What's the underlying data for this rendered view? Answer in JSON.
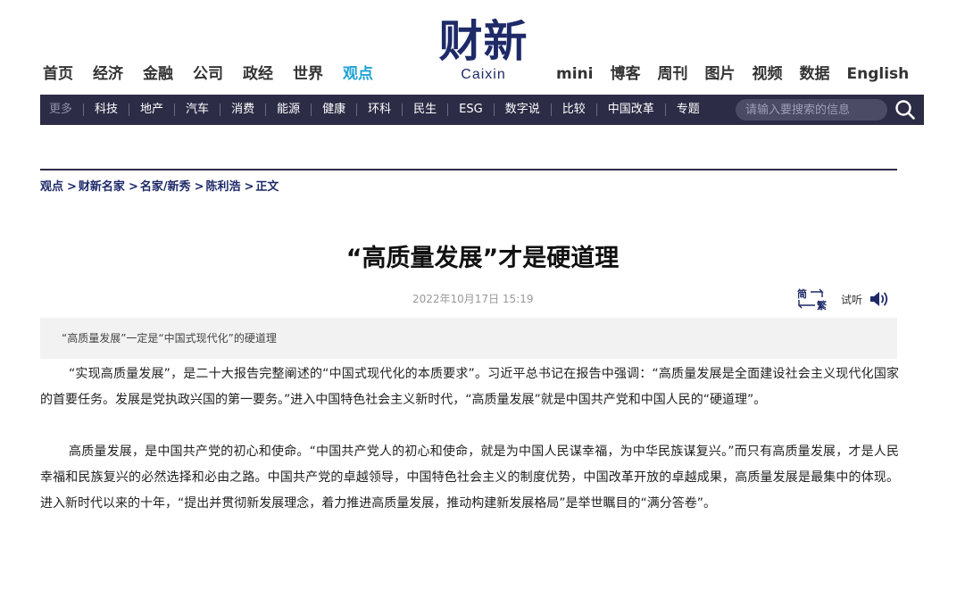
{
  "logo": {
    "cn": "财新",
    "en": "Caixin"
  },
  "nav_left": [
    {
      "label": "首页",
      "active": false
    },
    {
      "label": "经济",
      "active": false
    },
    {
      "label": "金融",
      "active": false
    },
    {
      "label": "公司",
      "active": false
    },
    {
      "label": "政经",
      "active": false
    },
    {
      "label": "世界",
      "active": false
    },
    {
      "label": "观点",
      "active": true
    }
  ],
  "nav_right": [
    "mini",
    "博客",
    "周刊",
    "图片",
    "视频",
    "数据",
    "English"
  ],
  "subnav": [
    "更多",
    "科技",
    "地产",
    "汽车",
    "消费",
    "能源",
    "健康",
    "环科",
    "民生",
    "ESG",
    "数字说",
    "比较",
    "中国改革",
    "专题"
  ],
  "search": {
    "placeholder": "请输入要搜索的信息",
    "icon": "search-icon"
  },
  "breadcrumb": [
    "观点",
    "财新名家",
    "名家/新秀",
    "陈利浩",
    "正文"
  ],
  "breadcrumb_sep": ">",
  "article": {
    "title": "“高质量发展”才是硬道理",
    "date": "2022年10月17日 15:19",
    "convert_icon": "simplified-traditional-icon",
    "convert_chars": [
      "简",
      "繁"
    ],
    "listen_label": "试听",
    "summary": "“高质量发展”一定是“中国式现代化”的硬道理",
    "paragraphs": [
      "“实现高质量发展”，是二十大报告完整阐述的“中国式现代化的本质要求”。习近平总书记在报告中强调：“高质量发展是全面建设社会主义现代化国家的首要任务。发展是党执政兴国的第一要务。”进入中国特色社会主义新时代，“高质量发展”就是中国共产党和中国人民的“硬道理”。",
      "高质量发展，是中国共产党的初心和使命。“中国共产党人的初心和使命，就是为中国人民谋幸福，为中华民族谋复兴。”而只有高质量发展，才是人民幸福和民族复兴的必然选择和必由之路。中国共产党的卓越领导，中国特色社会主义的制度优势，中国改革开放的卓越成果，高质量发展是最集中的体现。进入新时代以来的十年，“提出并贯彻新发展理念，着力推进高质量发展，推动构建新发展格局”是举世瞩目的“满分答卷”。"
    ]
  },
  "colors": {
    "brand": "#1e2a68",
    "accent": "#1ea2d6",
    "subnav_bg": "#2c2c47"
  }
}
